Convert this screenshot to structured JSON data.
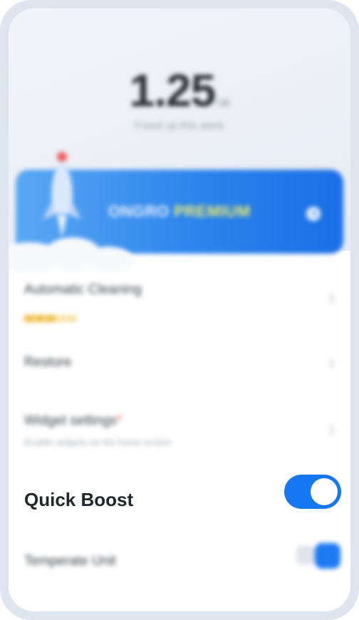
{
  "stats": {
    "value": "1.25",
    "unit": "GB",
    "caption": "Freed up this week"
  },
  "premium_banner": {
    "label_part1": "ONGRO",
    "label_part2": "PREMIUM",
    "accent_color": "#f2ee6a",
    "icon": "chevron-right-icon"
  },
  "settings": {
    "automatic_cleaning": {
      "label": "Automatic Cleaning",
      "rating": 3,
      "rating_max": 5
    },
    "restore": {
      "label": "Restore"
    },
    "widget_settings": {
      "label": "Widget settings",
      "badge": "*",
      "sublabel": "Enable widgets on the home screen"
    },
    "quick_boost": {
      "label": "Quick Boost",
      "enabled": true
    },
    "temperature_unit": {
      "label": "Temperate Unit",
      "selected": "°F"
    }
  },
  "colors": {
    "accent": "#1677f2",
    "banner_start": "#5aa8f3",
    "banner_end": "#1a6fe6"
  }
}
